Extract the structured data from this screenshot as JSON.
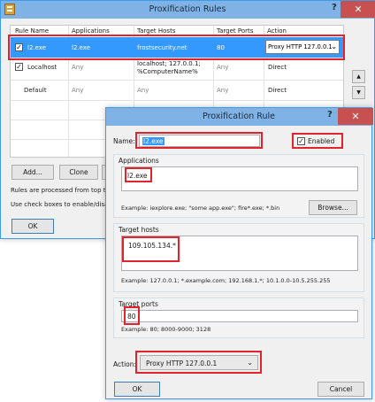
{
  "rules_window": {
    "title": "Proxification Rules",
    "help_icon": "?",
    "close_icon": "✕",
    "columns": [
      "Rule Name",
      "Applications",
      "Target Hosts",
      "Target Ports",
      "Action"
    ],
    "rows": [
      {
        "checked": true,
        "name": "l2.exe",
        "apps": "l2.exe",
        "hosts": "frostsecurity.net",
        "hosts2": "",
        "ports": "80",
        "action": "Proxy HTTP 127.0.0.1"
      },
      {
        "checked": true,
        "name": "Localhost",
        "apps": "Any",
        "hosts": "localhost; 127.0.0.1;",
        "hosts2": "%ComputerName%",
        "ports": "Any",
        "action": "Direct"
      },
      {
        "checked": false,
        "name": "Default",
        "apps": "Any",
        "hosts": "Any",
        "hosts2": "",
        "ports": "Any",
        "action": "Direct"
      }
    ],
    "add_label": "Add...",
    "clone_label": "Clone",
    "info_line1": "Rules are processed from top to bot",
    "info_line2": "Use check boxes to enable/disable a",
    "ok_label": "OK",
    "up_arrow": "▲",
    "down_arrow": "▼",
    "selected_row_color": "#3399ff",
    "highlight_color": "#e0232d"
  },
  "rule_dialog": {
    "title": "Proxification Rule",
    "help_icon": "?",
    "close_icon": "✕",
    "name_label": "Name:",
    "name_value": "l2.exe",
    "enabled_label": "Enabled",
    "enabled": true,
    "applications_label": "Applications",
    "applications_value": "l2.exe",
    "applications_example": "Example: iexplore.exe; \"some app.exe\"; fire*.exe; *.bin",
    "browse_label": "Browse...",
    "target_hosts_label": "Target hosts",
    "target_hosts_value": "109.105.134.*",
    "target_hosts_example": "Example: 127.0.0.1; *.example.com; 192.168.1.*; 10.1.0.0-10.5.255.255",
    "target_ports_label": "Target ports",
    "target_ports_value": "80",
    "target_ports_example": "Example: 80; 8000-9000; 3128",
    "action_label": "Action:",
    "action_value": "Proxy HTTP 127.0.0.1",
    "ok_label": "OK",
    "cancel_label": "Cancel"
  }
}
